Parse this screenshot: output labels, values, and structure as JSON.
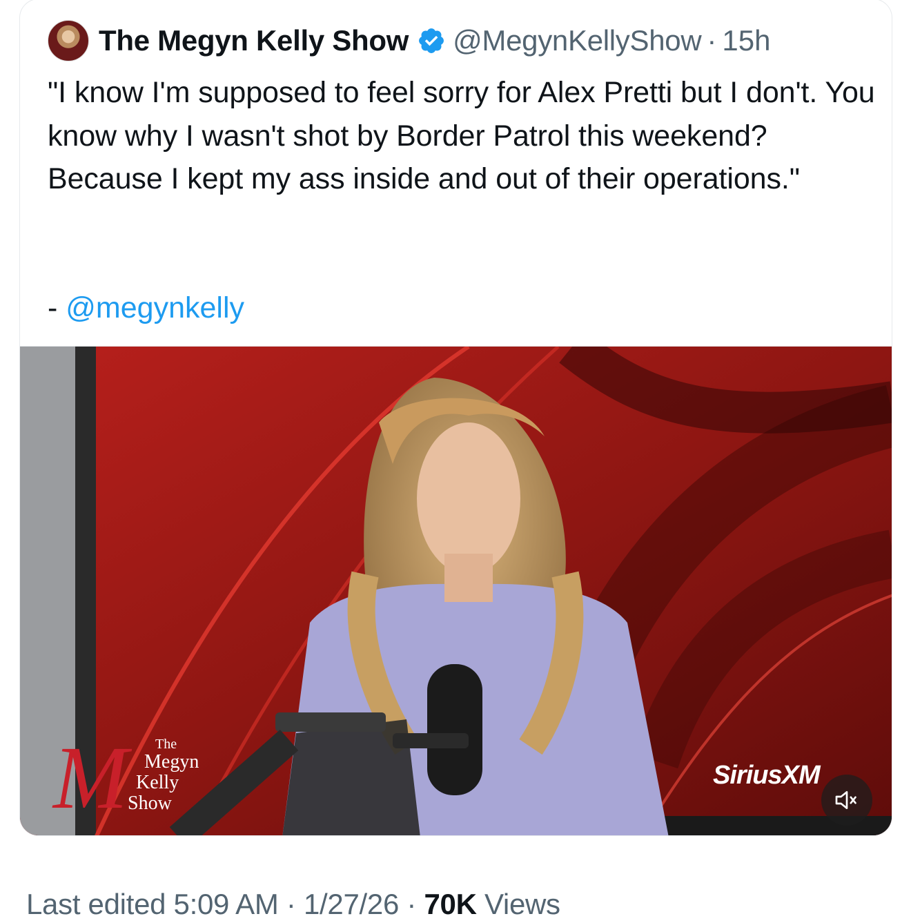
{
  "tweet": {
    "display_name": "The Megyn Kelly Show",
    "handle": "@MegynKellyShow",
    "separator": "·",
    "time": "15h",
    "verified_icon": "verified-badge-icon",
    "text": "\"I know I'm supposed to feel sorry for Alex Pretti but I don't. You know why I wasn't shot by Border Patrol this weekend? Because I kept my ass inside and out of their operations.\"",
    "credit_dash": "-",
    "credit_mention": "@megynkelly"
  },
  "media": {
    "logo": {
      "m": "M",
      "the": "The",
      "megyn": "Megyn",
      "kelly": "Kelly",
      "show": "Show"
    },
    "watermark": "SiriusXM",
    "mute_icon": "speaker-muted-icon"
  },
  "footer": {
    "edited_label": "Last edited 5:09 AM · 1/27/26",
    "separator": " · ",
    "views_count": "70K",
    "views_label": " Views"
  },
  "colors": {
    "link": "#1d9bf0",
    "secondary_text": "#536471",
    "primary_text": "#0f1419",
    "verified": "#1d9bf0",
    "background_red": "#7a1210"
  }
}
